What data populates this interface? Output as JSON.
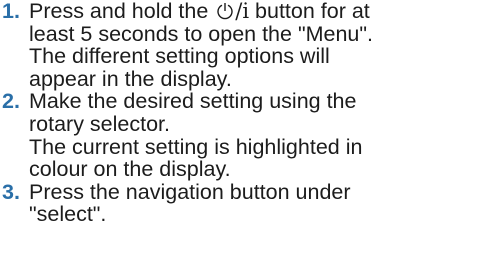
{
  "steps": [
    {
      "number": "1.",
      "lines": {
        "l1_prefix": "Press and hold the ",
        "button_symbol": "/i",
        "l1_suffix": " button for at",
        "l2": "least 5 seconds to open the \"Menu\".",
        "l3": "The different setting options will",
        "l4": "appear in the display."
      },
      "icon": "power-standby-icon"
    },
    {
      "number": "2.",
      "lines": {
        "l1": "Make the desired setting using the",
        "l2": "rotary selector.",
        "l3": "The current setting is highlighted in",
        "l4": "colour on the display."
      }
    },
    {
      "number": "3.",
      "lines": {
        "l1": "Press the navigation button under",
        "l2": "\"select\"."
      }
    }
  ],
  "colors": {
    "step_number": "#2a6fa8",
    "text": "#1c1c1c"
  }
}
